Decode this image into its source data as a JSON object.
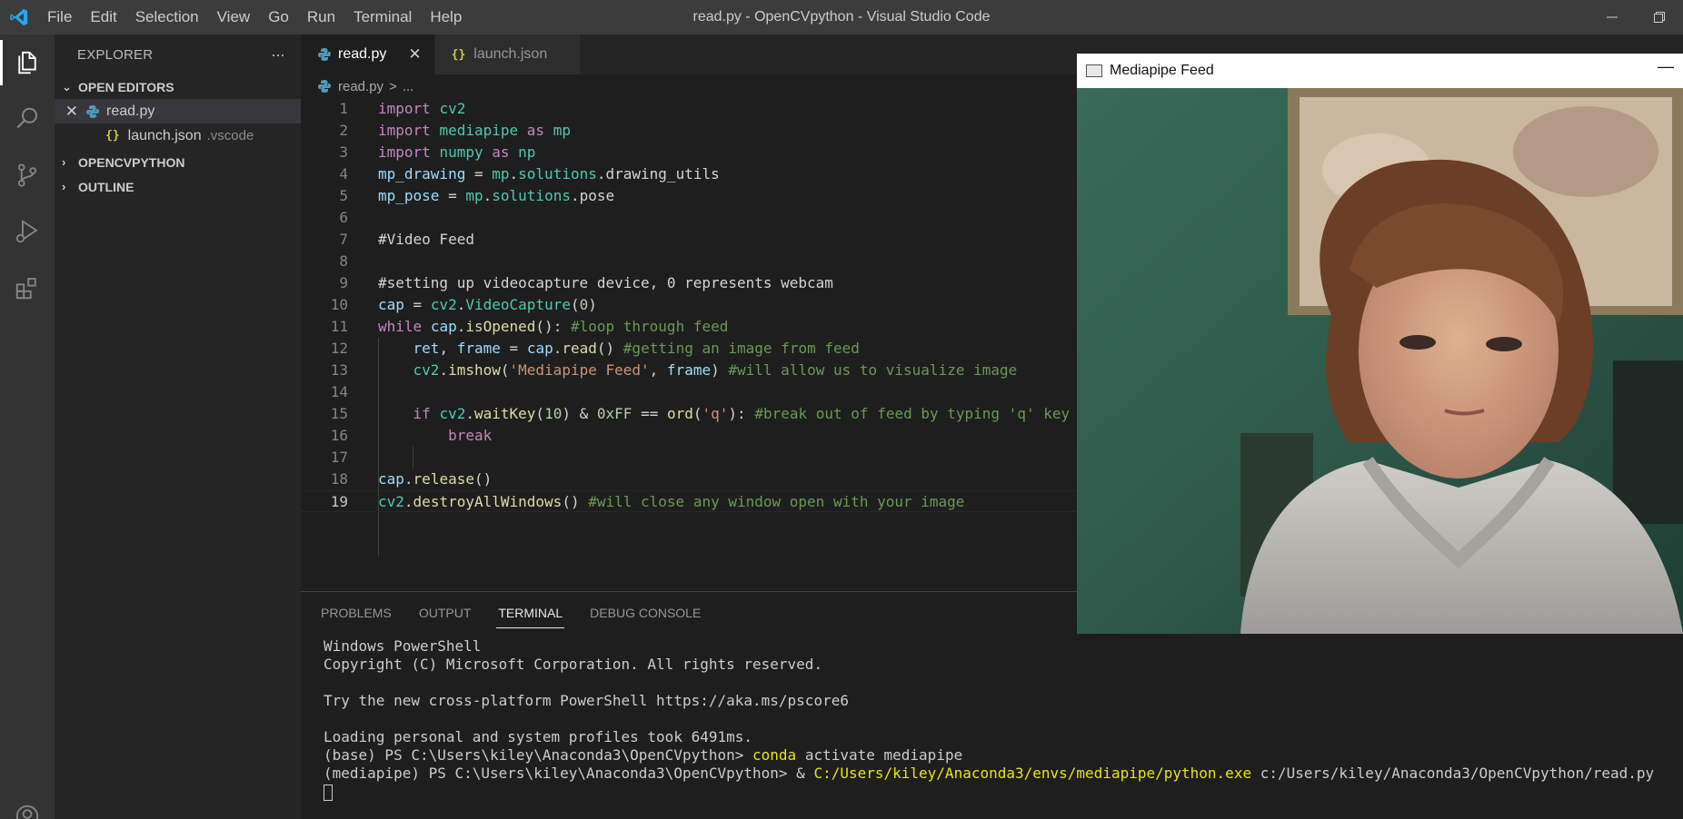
{
  "window_title": "read.py - OpenCVpython - Visual Studio Code",
  "menu": [
    "File",
    "Edit",
    "Selection",
    "View",
    "Go",
    "Run",
    "Terminal",
    "Help"
  ],
  "activity_bar": [
    "explorer-icon",
    "search-icon",
    "source-control-icon",
    "run-debug-icon",
    "extensions-icon",
    "account-icon"
  ],
  "sidebar": {
    "title": "EXPLORER",
    "more": "···",
    "open_editors_label": "OPEN EDITORS",
    "open_editors": [
      {
        "name": "read.py",
        "desc": ""
      },
      {
        "name": "launch.json",
        "desc": ".vscode"
      }
    ],
    "project_label": "OPENCVPYTHON",
    "outline_label": "OUTLINE"
  },
  "tabs": [
    {
      "label": "read.py",
      "active": true
    },
    {
      "label": "launch.json",
      "active": false
    }
  ],
  "breadcrumb": {
    "file": "read.py",
    "sep": ">",
    "rest": "..."
  },
  "code": [
    "import cv2",
    "import mediapipe as mp",
    "import numpy as np",
    "mp_drawing = mp.solutions.drawing_utils",
    "mp_pose = mp.solutions.pose",
    "",
    "#Video Feed",
    "",
    "#setting up videocapture device, 0 represents webcam",
    "cap = cv2.VideoCapture(0)",
    "while cap.isOpened(): #loop through feed",
    "    ret, frame = cap.read() #getting an image from feed",
    "    cv2.imshow('Mediapipe Feed', frame) #will allow us to visualize image",
    "",
    "    if cv2.waitKey(10) & 0xFF == ord('q'): #break out of feed by typing 'q' key",
    "        break",
    "",
    "cap.release()",
    "cv2.destroyAllWindows() #will close any window open with your image"
  ],
  "line_numbers": [
    "1",
    "2",
    "3",
    "4",
    "5",
    "6",
    "7",
    "8",
    "9",
    "10",
    "11",
    "12",
    "13",
    "14",
    "15",
    "16",
    "17",
    "18",
    "19"
  ],
  "panel": {
    "tabs": [
      "PROBLEMS",
      "OUTPUT",
      "TERMINAL",
      "DEBUG CONSOLE"
    ],
    "active_tab": "TERMINAL"
  },
  "terminal": {
    "line1": "Windows PowerShell",
    "line2": "Copyright (C) Microsoft Corporation. All rights reserved.",
    "line3": "",
    "line4": "Try the new cross-platform PowerShell https://aka.ms/pscore6",
    "line5": "",
    "line6": "Loading personal and system profiles took 6491ms.",
    "line7_prompt": "(base) PS C:\\Users\\kiley\\Anaconda3\\OpenCVpython> ",
    "line7_cmd": "conda",
    "line7_args": " activate mediapipe",
    "line8_prompt": "(mediapipe) PS C:\\Users\\kiley\\Anaconda3\\OpenCVpython> & ",
    "line8_exe": "C:/Users/kiley/Anaconda3/envs/mediapipe/python.exe",
    "line8_args": " c:/Users/kiley/Anaconda3/OpenCVpython/read.py"
  },
  "popup": {
    "title": "Mediapipe Feed"
  }
}
